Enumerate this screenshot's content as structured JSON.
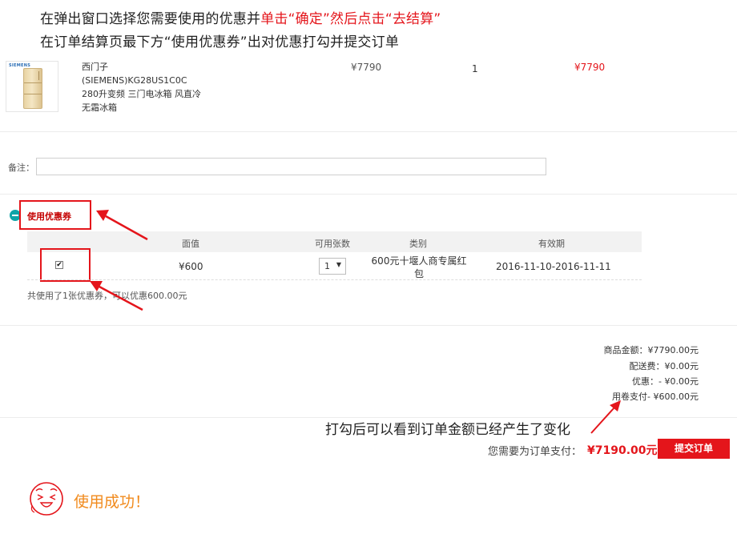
{
  "instructions": {
    "line1_a": "在弹出窗口选择您需要使用的优惠并",
    "line1_b": "单击“确定”然后点击“去结算”",
    "line2": "在订单结算页最下方“使用优惠券”出对优惠打勾并提交订单"
  },
  "product": {
    "image_brand": "SIEMENS",
    "name": "西门子(SIEMENS)KG28US1C0C 280升变频 三门电冰箱 风直冷无霜冰箱",
    "price": "¥7790",
    "quantity": "1",
    "subtotal": "¥7790"
  },
  "remark": {
    "label": "备注：",
    "value": ""
  },
  "coupon": {
    "title": "使用优惠券",
    "headers": {
      "face_value": "面值",
      "available": "可用张数",
      "type": "类别",
      "validity": "有效期"
    },
    "row": {
      "checked": true,
      "checkmark": "✔",
      "face_value": "¥600",
      "available": "1",
      "type": "600元十堰人商专属红包",
      "validity": "2016-11-10-2016-11-11"
    },
    "summary": "共使用了1张优惠券，可以优惠600.00元"
  },
  "totals": {
    "goods": "商品金额：¥7790.00元",
    "shipping": "配送费：¥0.00元",
    "discount": "优惠：- ¥0.00元",
    "coupon_pay": "用卷支付- ¥600.00元"
  },
  "annotation": "打勾后可以看到订单金额已经产生了变化",
  "payment": {
    "label": "您需要为订单支付：",
    "amount": "¥7190.00元",
    "submit_label": "提交订单"
  },
  "success_message": "使用成功！",
  "colors": {
    "accent_red": "#e4151b",
    "teal": "#0fa4a8",
    "orange": "#f18a1c"
  }
}
